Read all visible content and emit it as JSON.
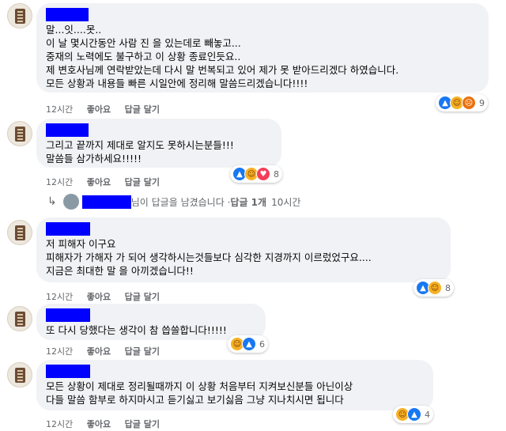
{
  "ui": {
    "like_label": "좋아요",
    "reply_label": "답글 달기"
  },
  "comments": [
    {
      "time": "12시간",
      "lines": [
        "말...잇....못..",
        "이 날 몇시간동안 사람 진 을 있는데로 빼놓고...",
        "중재의 노력에도 불구하고 이 상황 종료인듯요..",
        "제 변호사님께 연락받았는데 다시 말 번복되고 있어 제가 못 받아드리겠다 하였습니다.",
        "모든 상황과 내용들 빠른 시일안에 정리해 말씀드리겠습니다!!!!"
      ],
      "reactions": [
        "like-icon",
        "care-icon",
        "angry-icon"
      ],
      "reaction_count": "9"
    },
    {
      "time": "12시간",
      "lines": [
        "그리고 끝까지 제대로 알지도 못하시는분들!!!",
        "말씀들 삼가하세요!!!!!"
      ],
      "reactions": [
        "like-icon",
        "care-icon",
        "love-icon"
      ],
      "reaction_count": "8"
    },
    {
      "time": "12시간",
      "lines": [
        "저 피해자 이구요",
        "피해자가 가해자 가 되어 생각하시는것들보다 심각한 지경까지 이르렀었구요....",
        "지금은 최대한 말 을 아끼겠습니다!!"
      ],
      "reactions": [
        "like-icon",
        "care-icon"
      ],
      "reaction_count": "8"
    },
    {
      "time": "12시간",
      "lines": [
        "또 다시 당했다는 생각이 참 씁쓸합니다!!!!!"
      ],
      "reactions": [
        "care-icon",
        "like-icon"
      ],
      "reaction_count": "6"
    },
    {
      "time": "12시간",
      "lines": [
        "모든 상황이 제대로 정리될때까지 이 상황 처음부터 지켜보신분들 아닌이상",
        "다들 말씀 함부로 하지마시고 듣기싫고 보기싫음 그냥 지나치시면 됩니다"
      ],
      "reactions": [
        "care-icon",
        "like-icon"
      ],
      "reaction_count": "4"
    }
  ],
  "reply_summary": {
    "text": "님이 답글을 남겼습니다 · ",
    "count": "답글 1개",
    "time": "10시간"
  }
}
